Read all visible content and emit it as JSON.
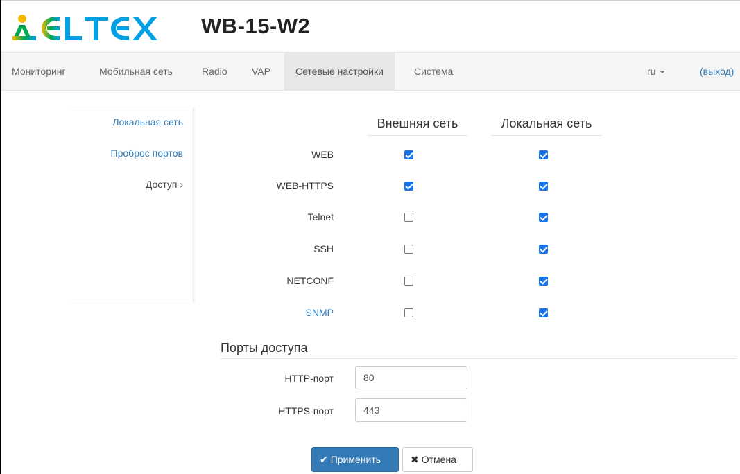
{
  "header": {
    "logo_text": "ELTEX",
    "model": "WB-15-W2"
  },
  "navbar": {
    "items": [
      {
        "label": "Мониторинг"
      },
      {
        "label": "Мобильная сеть"
      },
      {
        "label": "Radio"
      },
      {
        "label": "VAP"
      },
      {
        "label": "Сетевые настройки",
        "active": true
      },
      {
        "label": "Система"
      }
    ],
    "language": "ru",
    "logout": "(выход)"
  },
  "sidebar": {
    "items": [
      {
        "label": "Локальная сеть"
      },
      {
        "label": "Проброс портов"
      },
      {
        "label": "Доступ ›",
        "current": true
      }
    ]
  },
  "access": {
    "columns": [
      "Внешняя сеть",
      "Локальная сеть"
    ],
    "rows": [
      {
        "label": "WEB",
        "external": true,
        "local": true
      },
      {
        "label": "WEB-HTTPS",
        "external": true,
        "local": true
      },
      {
        "label": "Telnet",
        "external": false,
        "local": true
      },
      {
        "label": "SSH",
        "external": false,
        "local": true
      },
      {
        "label": "NETCONF",
        "external": false,
        "local": true
      },
      {
        "label": "SNMP",
        "external": false,
        "local": true
      }
    ]
  },
  "ports": {
    "title": "Порты доступа",
    "http_label": "HTTP-порт",
    "http_value": "80",
    "https_label": "HTTPS-порт",
    "https_value": "443"
  },
  "actions": {
    "apply": "Применить",
    "cancel": "Отмена"
  },
  "colors": {
    "brand_gradient": [
      "#f5b800",
      "#00a651",
      "#00a0e3"
    ],
    "primary": "#337ab7",
    "checkbox": "#1a73e8"
  },
  "icons": {
    "apply": "check-icon",
    "cancel": "times-icon",
    "language": "caret-down-icon"
  }
}
